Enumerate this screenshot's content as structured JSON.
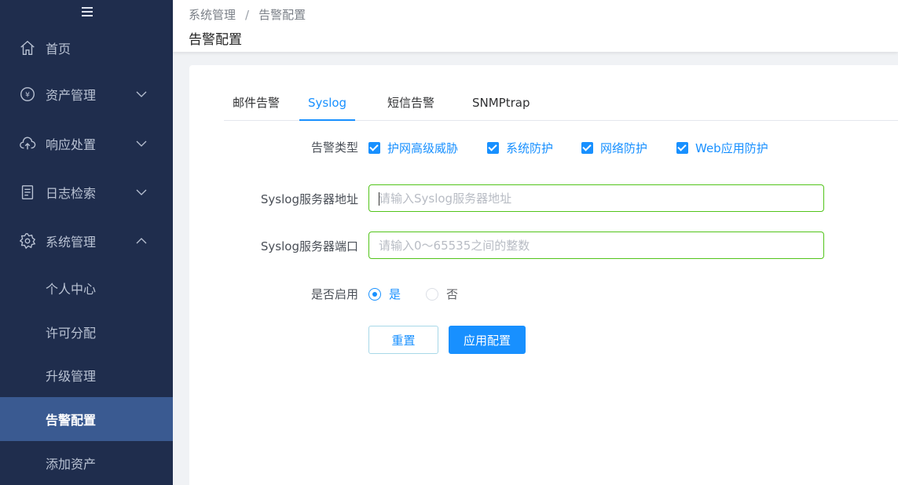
{
  "sidebar": {
    "menu": [
      {
        "label": "首页",
        "icon": "home-icon",
        "arrow": ""
      },
      {
        "label": "资产管理",
        "icon": "asset-icon",
        "arrow": "chevron-down-icon"
      },
      {
        "label": "响应处置",
        "icon": "cloud-upload-icon",
        "arrow": "chevron-down-icon"
      },
      {
        "label": "日志检索",
        "icon": "log-document-icon",
        "arrow": "chevron-down-icon"
      },
      {
        "label": "系统管理",
        "icon": "gear-icon",
        "arrow": "chevron-up-icon"
      }
    ],
    "sub_items": [
      {
        "label": "个人中心"
      },
      {
        "label": "许可分配"
      },
      {
        "label": "升级管理"
      },
      {
        "label": "告警配置",
        "active": true
      },
      {
        "label": "添加资产"
      }
    ],
    "colors": {
      "background": "#1f2d4d",
      "active": "#3a5a91"
    }
  },
  "header": {
    "breadcrumb": [
      "系统管理",
      "告警配置"
    ],
    "breadcrumb_separator": "/",
    "title": "告警配置"
  },
  "tabs": [
    {
      "label": "邮件告警"
    },
    {
      "label": "Syslog",
      "active": true
    },
    {
      "label": "短信告警"
    },
    {
      "label": "SNMPtrap"
    }
  ],
  "form": {
    "alert_type": {
      "label": "告警类型",
      "options": [
        {
          "label": "护网高级威胁",
          "checked": true
        },
        {
          "label": "系统防护",
          "checked": true
        },
        {
          "label": "网络防护",
          "checked": true
        },
        {
          "label": "Web应用防护",
          "checked": true
        }
      ]
    },
    "server_address": {
      "label": "Syslog服务器地址",
      "value": "",
      "placeholder": "请输入Syslog服务器地址"
    },
    "server_port": {
      "label": "Syslog服务器端口",
      "value": "",
      "placeholder": "请输入0～65535之间的整数"
    },
    "enable": {
      "label": "是否启用",
      "options": [
        {
          "label": "是",
          "checked": true
        },
        {
          "label": "否",
          "checked": false
        }
      ]
    },
    "reset_label": "重置",
    "apply_label": "应用配置"
  },
  "colors": {
    "primary": "#1890ff",
    "input_border_focus": "#52c41a"
  }
}
